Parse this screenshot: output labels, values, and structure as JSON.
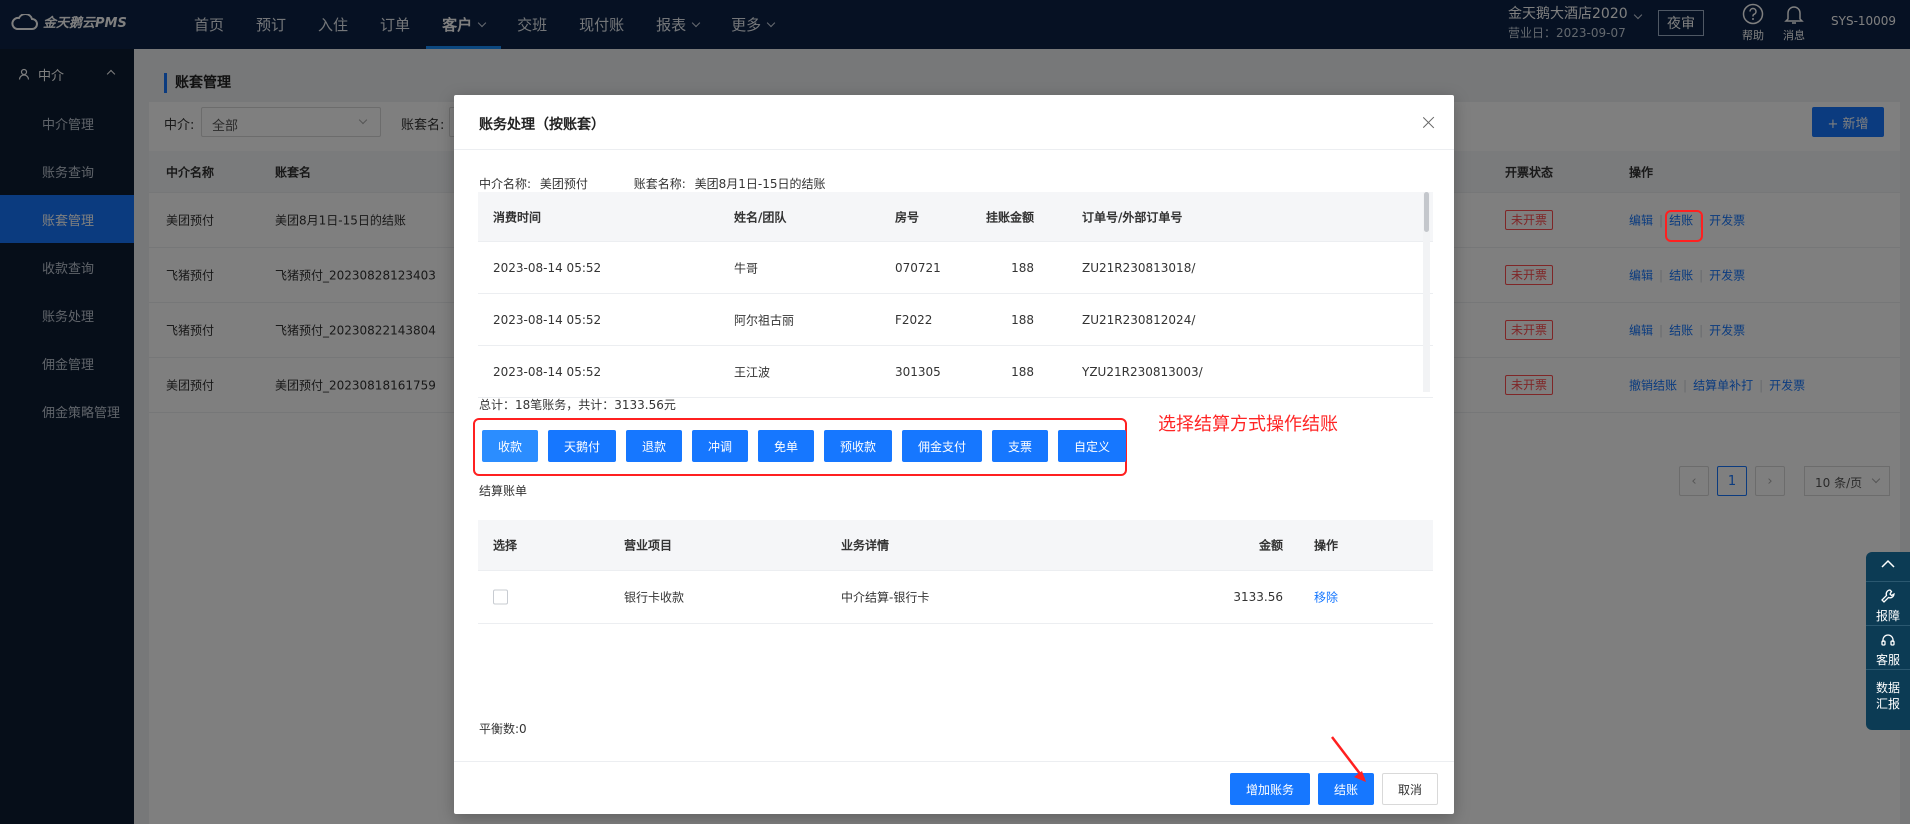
{
  "app": {
    "logo": "金天鹅云PMS"
  },
  "nav": [
    {
      "label": "首页"
    },
    {
      "label": "预订"
    },
    {
      "label": "入住"
    },
    {
      "label": "订单"
    },
    {
      "label": "客户",
      "active": true,
      "dropdown": true
    },
    {
      "label": "交班"
    },
    {
      "label": "现付账"
    },
    {
      "label": "报表",
      "dropdown": true
    },
    {
      "label": "更多",
      "dropdown": true
    }
  ],
  "header": {
    "hotel_name": "金天鹅大酒店2020",
    "business_day": "营业日：2023-09-07",
    "night_audit": "夜审",
    "help": "帮助",
    "messages": "消息",
    "user": "SYS-10009"
  },
  "sidebar": {
    "group": "中介",
    "items": [
      {
        "label": "中介管理"
      },
      {
        "label": "账务查询"
      },
      {
        "label": "账套管理",
        "active": true
      },
      {
        "label": "收款查询"
      },
      {
        "label": "账务处理"
      },
      {
        "label": "佣金管理"
      },
      {
        "label": "佣金策略管理"
      }
    ]
  },
  "page": {
    "title": "账套管理",
    "filter_agency_label": "中介:",
    "filter_agency_value": "全部",
    "filter_bookset_label": "账套名:",
    "add_button": "+ 新增"
  },
  "bg_table": {
    "headers": {
      "agency": "中介名称",
      "bookset": "账套名",
      "invoice_status": "开票状态",
      "actions": "操作"
    },
    "rows": [
      {
        "agency": "美团预付",
        "bookset": "美团8月1日-15日的结账",
        "invoice": "未开票",
        "actions": [
          "编辑",
          "结账",
          "开发票"
        ]
      },
      {
        "agency": "飞猪预付",
        "bookset": "飞猪预付_20230828123403",
        "invoice": "未开票",
        "actions": [
          "编辑",
          "结账",
          "开发票"
        ]
      },
      {
        "agency": "飞猪预付",
        "bookset": "飞猪预付_20230822143804",
        "invoice": "未开票",
        "actions": [
          "编辑",
          "结账",
          "开发票"
        ]
      },
      {
        "agency": "美团预付",
        "bookset": "美团预付_20230818161759",
        "invoice": "未开票",
        "actions": [
          "撤销结账",
          "结算单补打",
          "开发票"
        ]
      }
    ]
  },
  "pagination": {
    "current": "1",
    "page_size": "10 条/页"
  },
  "float_bar": {
    "report": "报障",
    "service": "客服",
    "data": "数据汇报"
  },
  "dialog": {
    "title": "账务处理（按账套）",
    "agency_label": "中介名称:",
    "agency_value": "美团预付",
    "bookset_label": "账套名称:",
    "bookset_value": "美团8月1日-15日的结账",
    "entries": {
      "headers": {
        "time": "消费时间",
        "guest": "姓名/团队",
        "room": "房号",
        "amount": "挂账金额",
        "order": "订单号/外部订单号"
      },
      "rows": [
        {
          "time": "2023-08-14 05:52",
          "guest": "牛哥",
          "room": "070721",
          "amount": "188",
          "order": "ZU21R230813018/"
        },
        {
          "time": "2023-08-14 05:52",
          "guest": "阿尔祖古丽",
          "room": "F2022",
          "amount": "188",
          "order": "ZU21R230812024/"
        },
        {
          "time": "2023-08-14 05:52",
          "guest": "王江波",
          "room": "301305",
          "amount": "188",
          "order": "YZU21R230813003/"
        }
      ]
    },
    "summary": "总计：18笔账务，共计：3133.56元",
    "methods": [
      "收款",
      "天鹅付",
      "退款",
      "冲调",
      "免单",
      "预收款",
      "佣金支付",
      "支票",
      "自定义"
    ],
    "annotation": "选择结算方式操作结账",
    "bill_label": "结算账单",
    "bill": {
      "headers": {
        "select": "选择",
        "item": "营业项目",
        "detail": "业务详情",
        "amount": "金额",
        "actions": "操作"
      },
      "rows": [
        {
          "item": "银行卡收款",
          "detail": "中介结算-银行卡",
          "amount": "3133.56",
          "action": "移除"
        }
      ]
    },
    "balance": "平衡数:0",
    "buttons": {
      "add": "增加账务",
      "settle": "结账",
      "cancel": "取消"
    }
  },
  "colors": {
    "primary": "#1677ff",
    "topbar": "#0c2346",
    "sidebar": "#0c1d33",
    "danger": "#ff2020"
  }
}
